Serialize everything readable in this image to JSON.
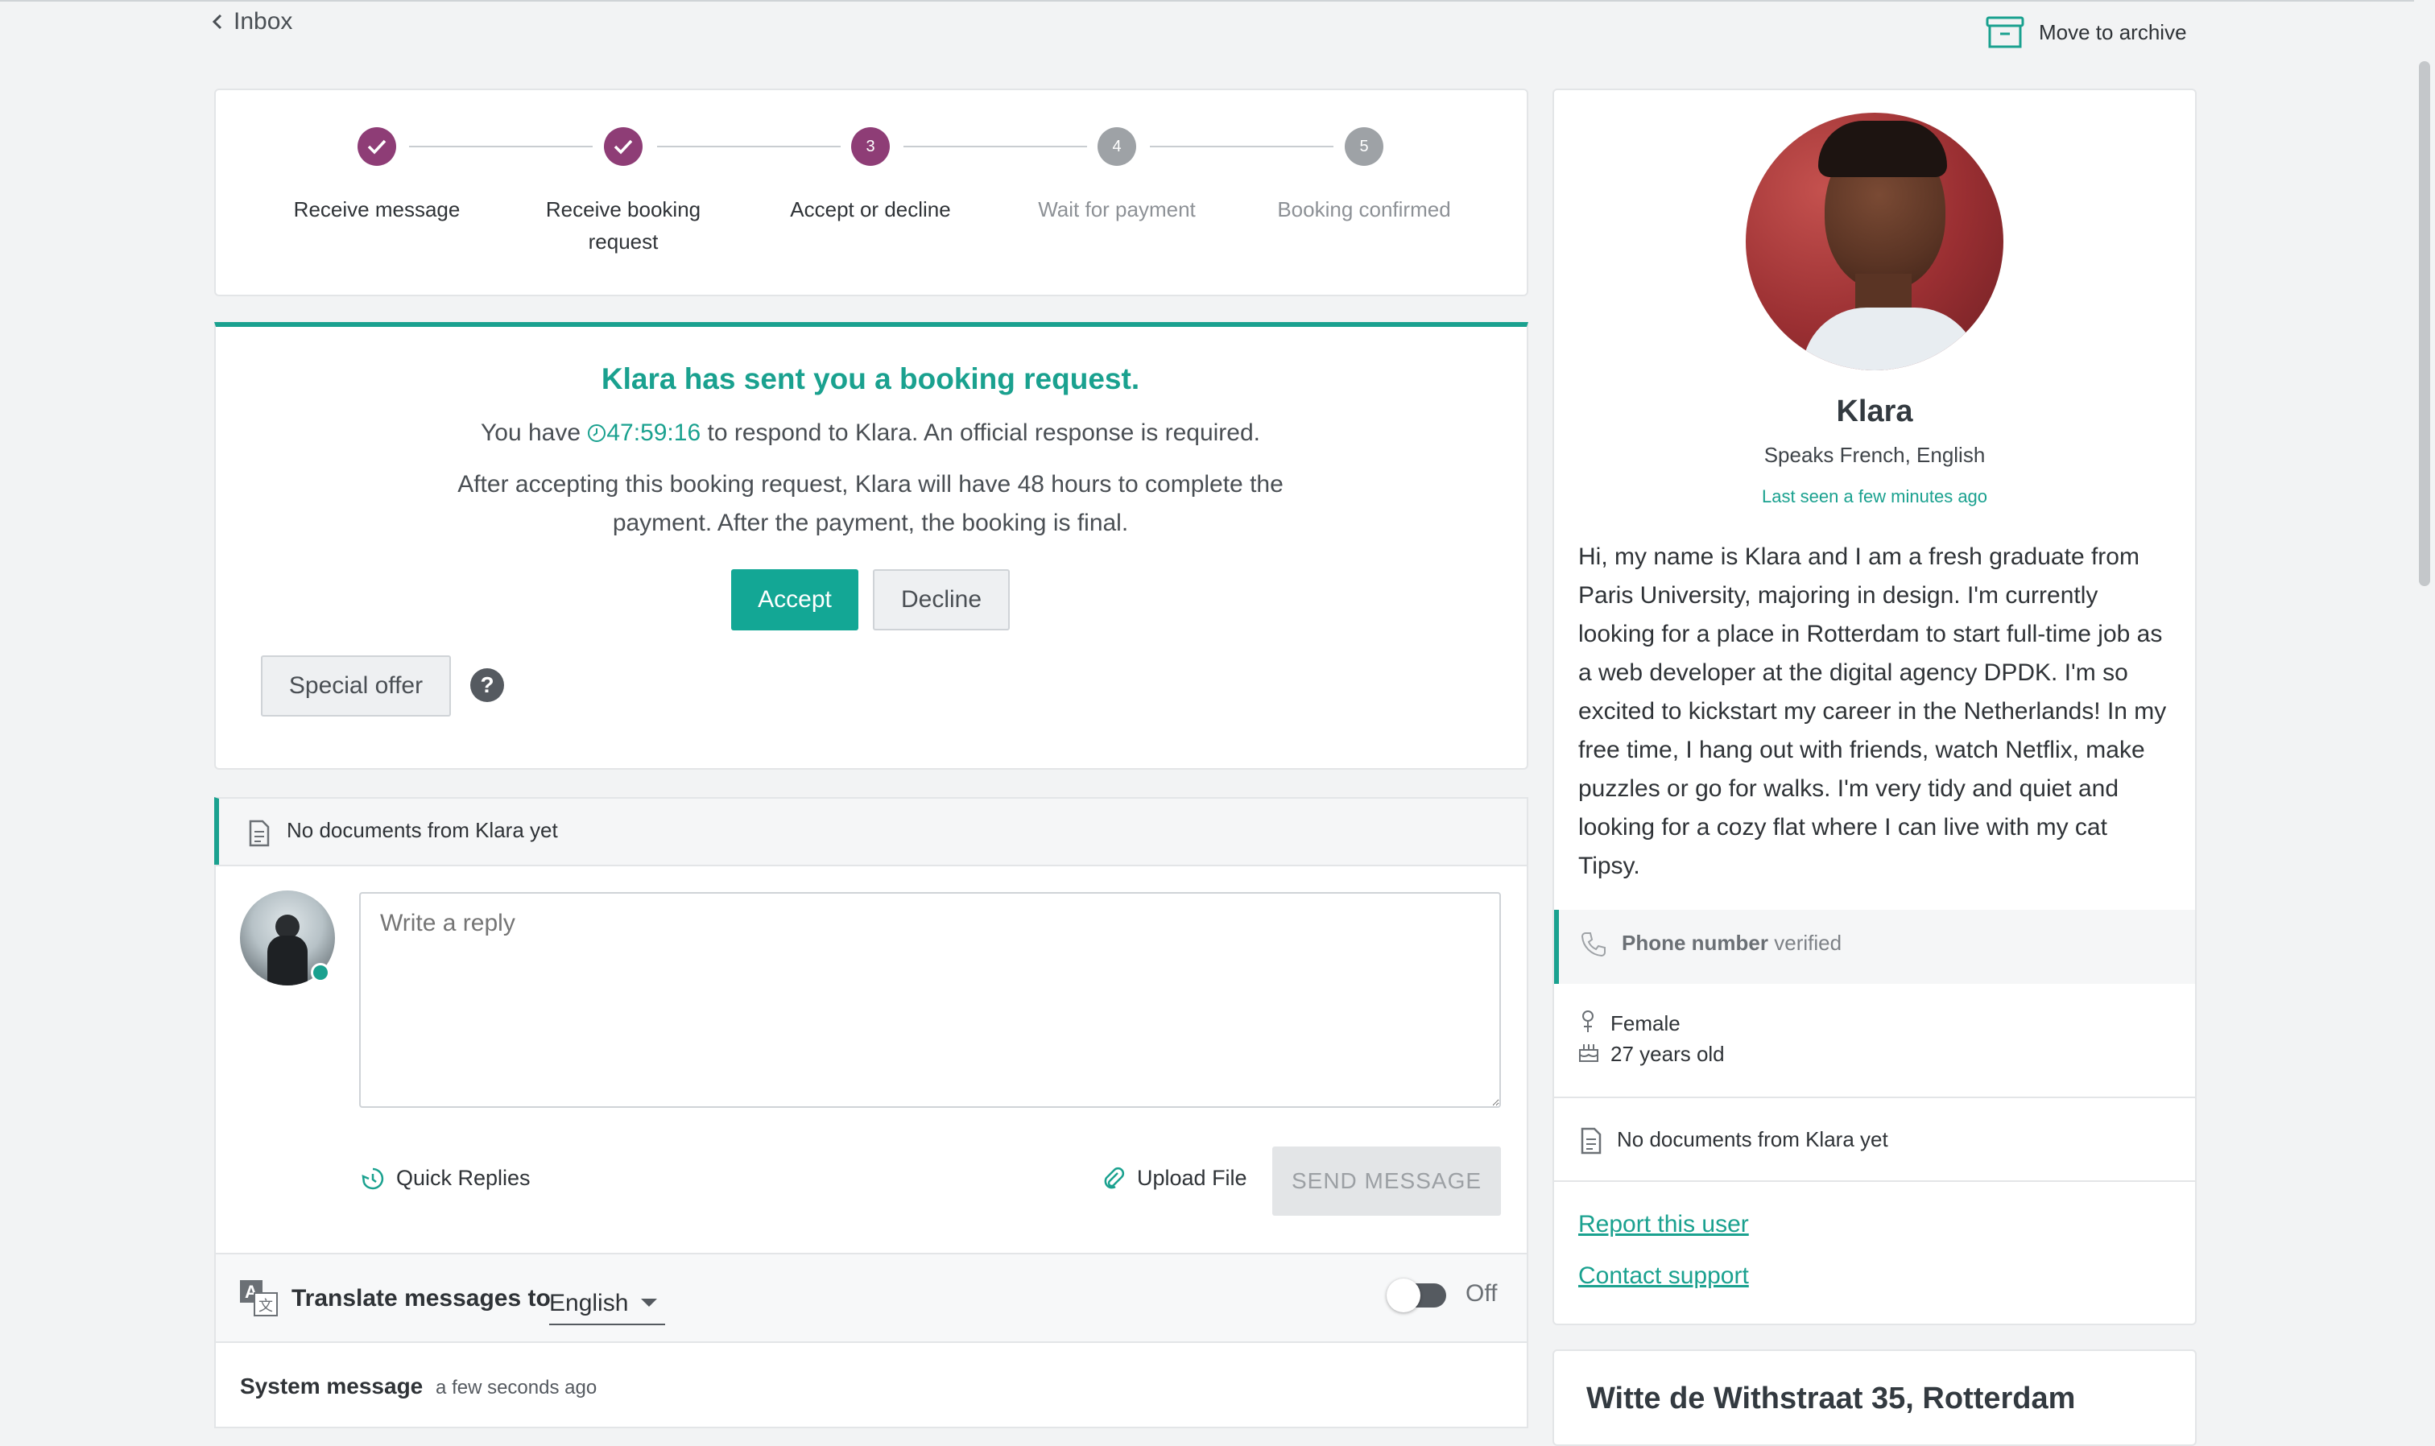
{
  "nav": {
    "back_label": "Inbox",
    "archive_label": "Move to archive"
  },
  "stepper": {
    "steps": [
      {
        "label_1": "Receive message",
        "label_2": "",
        "state": "done"
      },
      {
        "label_1": "Receive booking",
        "label_2": "request",
        "state": "done"
      },
      {
        "label_1": "Accept or decline",
        "label_2": "",
        "state": "active",
        "number": "3"
      },
      {
        "label_1": "Wait for payment",
        "label_2": "",
        "state": "todo",
        "number": "4"
      },
      {
        "label_1": "Booking confirmed",
        "label_2": "",
        "state": "todo",
        "number": "5"
      }
    ]
  },
  "booking": {
    "title": "Klara has sent you a booking request.",
    "respond_prefix": "You have",
    "timer": "47:59:16",
    "respond_suffix": "to respond to Klara. An official response is required.",
    "info_line_1": "After accepting this booking request, Klara will have 48 hours to complete the",
    "info_line_2": "payment. After the payment, the booking is final.",
    "accept_label": "Accept",
    "decline_label": "Decline",
    "special_offer_label": "Special offer",
    "help_label": "?"
  },
  "documents_bar": {
    "text": "No documents from Klara yet"
  },
  "reply": {
    "placeholder": "Write a reply",
    "quick_replies_label": "Quick Replies",
    "upload_label": "Upload File",
    "send_label": "SEND MESSAGE"
  },
  "translate": {
    "label": "Translate messages to",
    "language": "English",
    "toggle_state": "Off"
  },
  "system_message": {
    "title": "System message",
    "time": "a few seconds ago"
  },
  "profile": {
    "name": "Klara",
    "languages": "Speaks French, English",
    "last_seen": "Last seen a few minutes ago",
    "bio_lines": [
      "Hi, my name is Klara and I am a fresh graduate from",
      "Paris University, majoring in design. I'm currently",
      "looking for a place in Rotterdam to start full-time job as",
      "a web developer at the digital agency DPDK. I'm so",
      "excited to kickstart my career in the Netherlands! In my",
      "free time, I hang out with friends, watch Netflix, make",
      "puzzles or go for walks. I'm very tidy and quiet and",
      "looking for a cozy flat where I can live with my cat",
      "Tipsy."
    ],
    "phone_label": "Phone number",
    "phone_status": "verified",
    "gender": "Female",
    "age": "27 years old",
    "documents": "No documents from Klara yet",
    "report_link": "Report this user",
    "support_link": "Contact support"
  },
  "address_card": {
    "title": "Witte de Withstraat 35, Rotterdam"
  },
  "colors": {
    "accent": "#1aa18f",
    "step_purple": "#8e3d76",
    "step_grey": "#9ea2a6"
  }
}
